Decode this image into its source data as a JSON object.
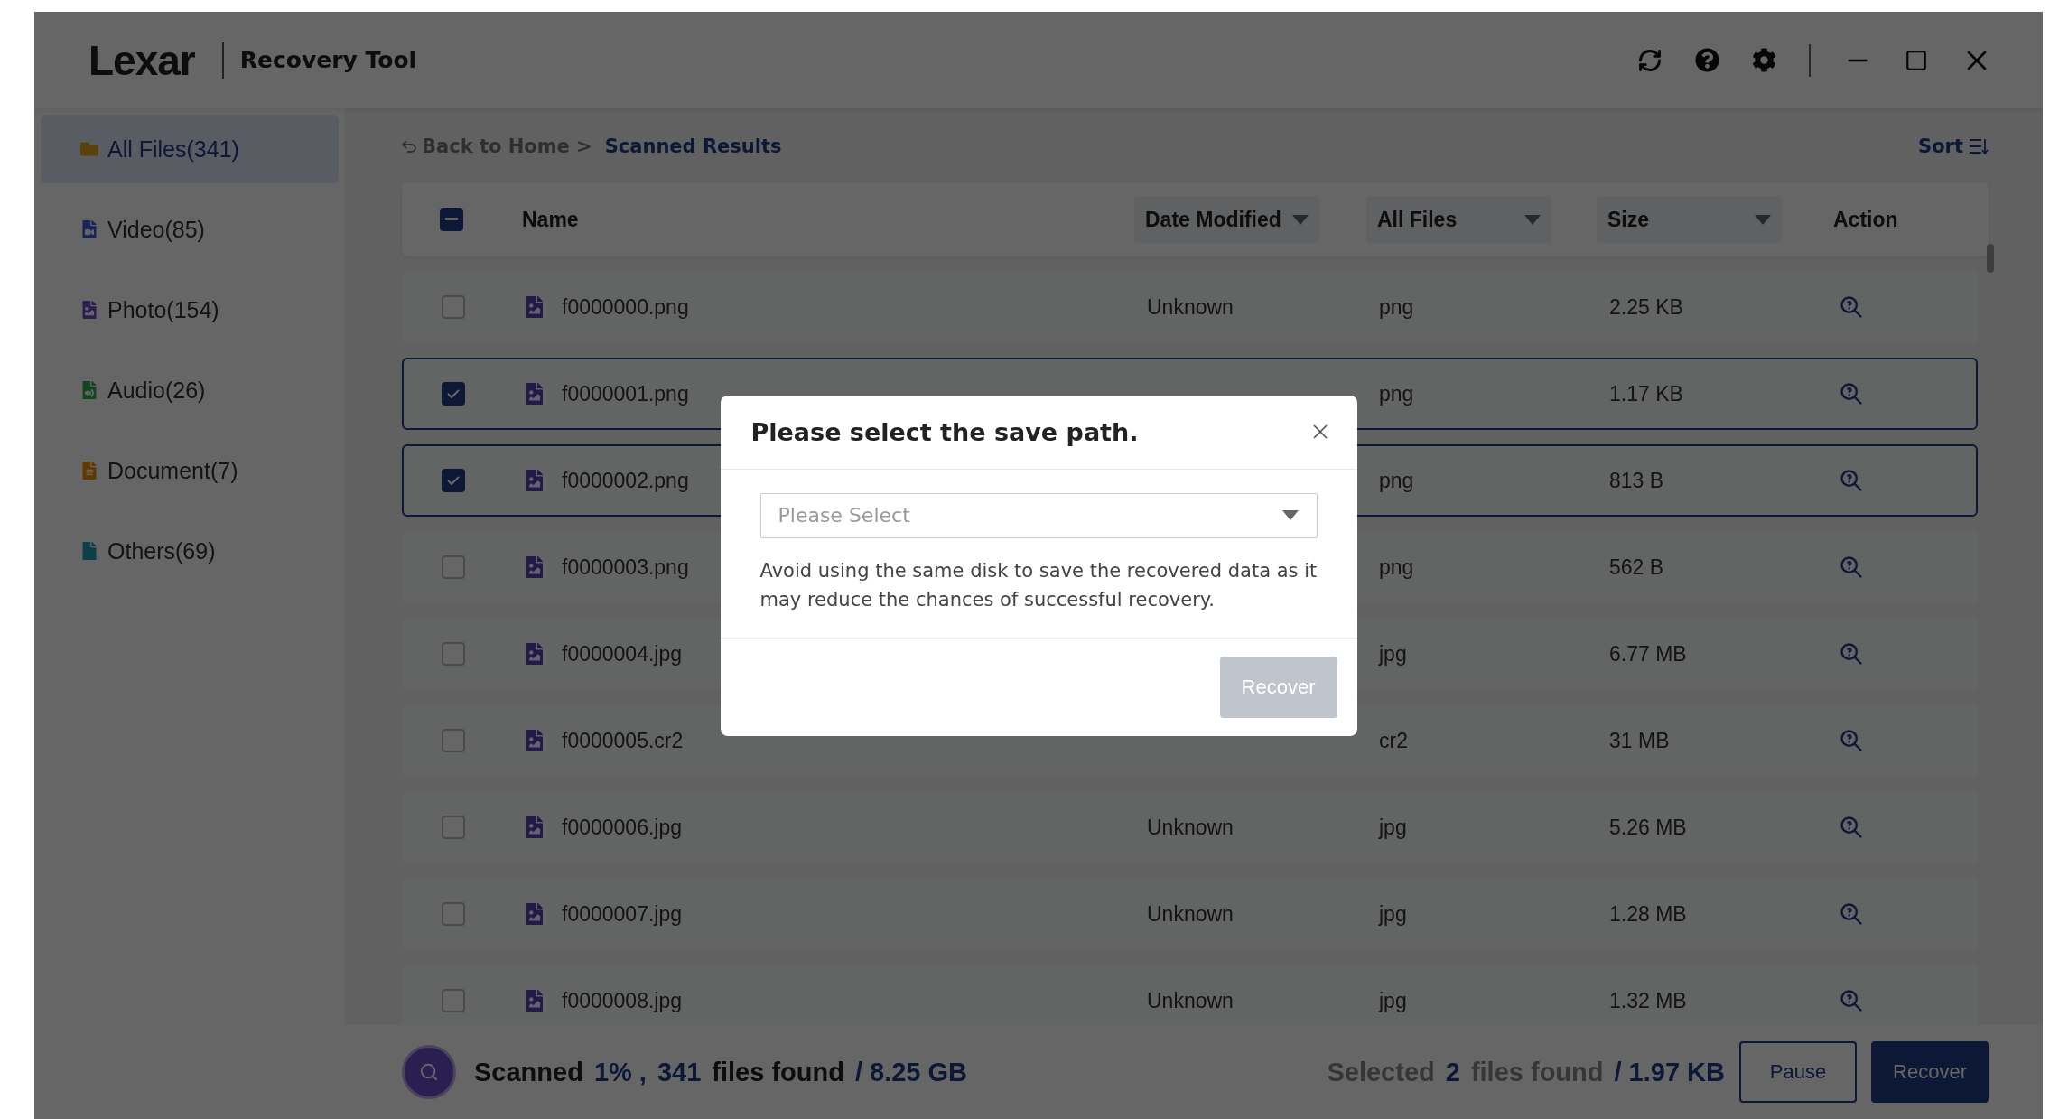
{
  "app": {
    "logo": "Lexar",
    "title": "Recovery Tool"
  },
  "sidebar": {
    "items": [
      {
        "label": "All Files(341)",
        "selected": true,
        "color": "#5a420e"
      },
      {
        "label": "Video(85)",
        "selected": false,
        "color": "#182458"
      },
      {
        "label": "Photo(154)",
        "selected": false,
        "color": "#2c1e50"
      },
      {
        "label": "Audio(26)",
        "selected": false,
        "color": "#144420"
      },
      {
        "label": "Document(7)",
        "selected": false,
        "color": "#603800"
      },
      {
        "label": "Others(69)",
        "selected": false,
        "color": "#0c4046"
      }
    ]
  },
  "breadcrumb": {
    "back": "Back to Home >",
    "current": "Scanned Results"
  },
  "sort": "Sort",
  "table": {
    "select_all_indeterminate": true,
    "columns": [
      {
        "label": "Name",
        "kind": "plain"
      },
      {
        "label": "Date Modified",
        "kind": "dropdown"
      },
      {
        "label": "All Files",
        "kind": "dropdown"
      },
      {
        "label": "Size",
        "kind": "dropdown"
      },
      {
        "label": "Action",
        "kind": "plain"
      }
    ],
    "rows": [
      {
        "name": "f0000000.png",
        "date": "Unknown",
        "type": "png",
        "size": "2.25 KB",
        "selected": false
      },
      {
        "name": "f0000001.png",
        "type": "png",
        "size": "1.17 KB",
        "selected": true
      },
      {
        "name": "f0000002.png",
        "type": "png",
        "size": "813 B",
        "selected": true
      },
      {
        "name": "f0000003.png",
        "type": "png",
        "size": "562 B",
        "selected": false
      },
      {
        "name": "f0000004.jpg",
        "type": "jpg",
        "size": "6.77 MB",
        "selected": false
      },
      {
        "name": "f0000005.cr2",
        "type": "cr2",
        "size": "31 MB",
        "selected": false
      },
      {
        "name": "f0000006.jpg",
        "date": "Unknown",
        "type": "jpg",
        "size": "5.26 MB",
        "selected": false
      },
      {
        "name": "f0000007.jpg",
        "date": "Unknown",
        "type": "jpg",
        "size": "1.28 MB",
        "selected": false
      },
      {
        "name": "f0000008.jpg",
        "date": "Unknown",
        "type": "jpg",
        "size": "1.32 MB",
        "selected": false
      }
    ]
  },
  "status": {
    "label": "Scanned",
    "percent": "1% ,",
    "count": "341",
    "found": "files found",
    "total": "/ 8.25 GB",
    "selected_label": "Selected",
    "selected_count": "2",
    "selected_found": "files found",
    "selected_total": "/ 1.97 KB",
    "pause": "Pause",
    "recover": "Recover"
  },
  "dialog": {
    "title": "Please select the save path.",
    "placeholder": "Please Select",
    "note": "Avoid using the same disk to save the recovered data as it may reduce the chances of successful recovery.",
    "button": {
      "label": "Recover",
      "disabled": true
    }
  }
}
